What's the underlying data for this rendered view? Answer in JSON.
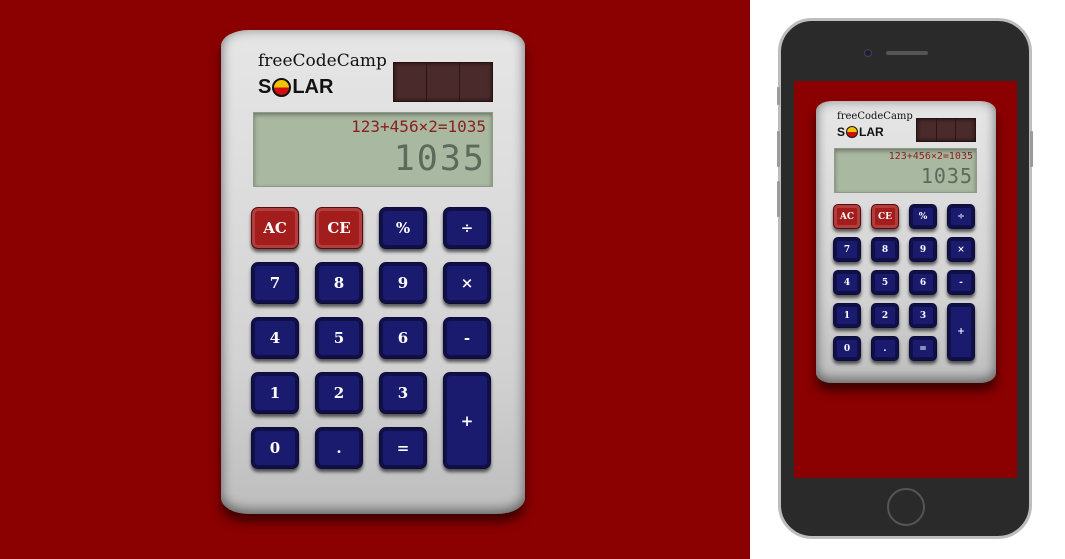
{
  "brand": {
    "line1": "freeCodeCamp",
    "solar_s": "S",
    "solar_rest": "LAR"
  },
  "display": {
    "expression": "123+456×2=1035",
    "result": "1035"
  },
  "keys": {
    "ac": "AC",
    "ce": "CE",
    "percent": "%",
    "divide": "÷",
    "seven": "7",
    "eight": "8",
    "nine": "9",
    "multiply": "×",
    "four": "4",
    "five": "5",
    "six": "6",
    "minus": "-",
    "one": "1",
    "two": "2",
    "three": "3",
    "plus": "+",
    "zero": "0",
    "decimal": ".",
    "equals": "="
  },
  "colors": {
    "background": "#8b0000",
    "key_blue": "#1a1a6e",
    "key_red": "#a31d1d",
    "display": "#a9b8a0"
  }
}
